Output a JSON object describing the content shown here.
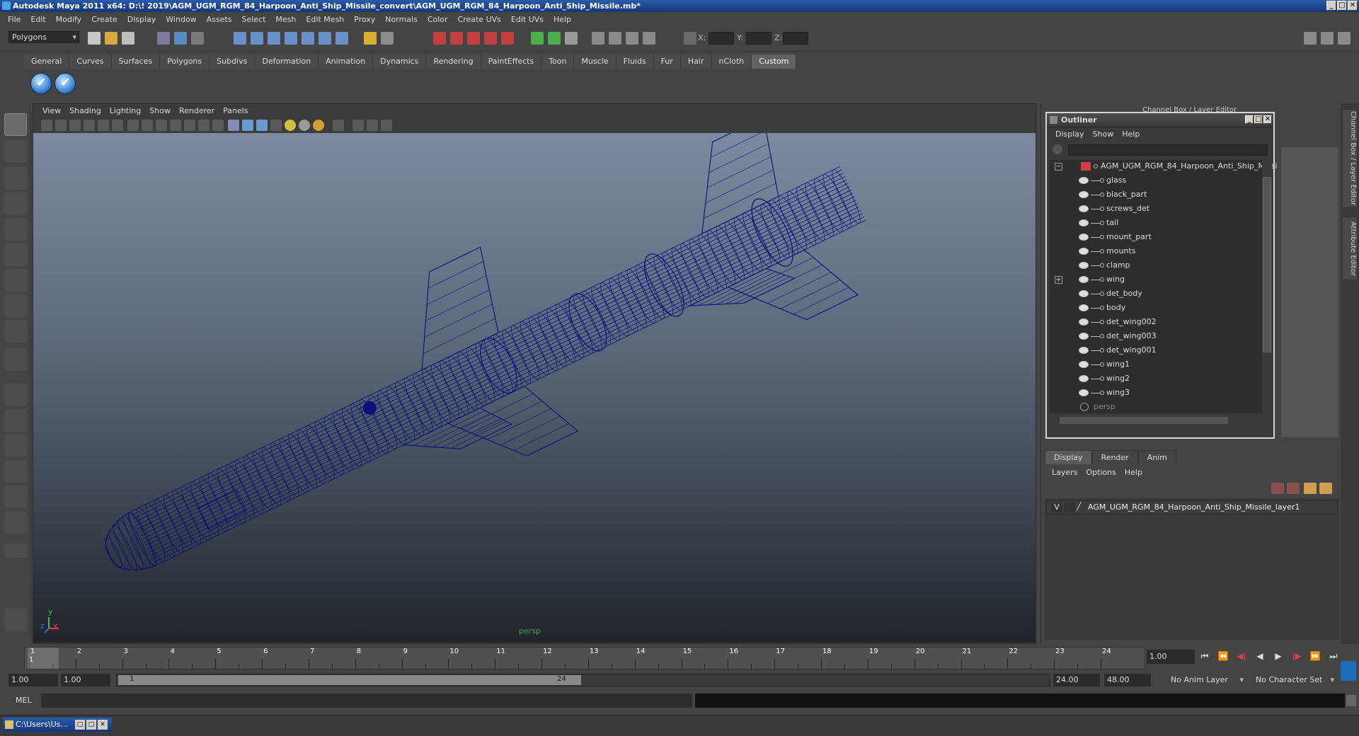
{
  "app": {
    "title": "Autodesk Maya 2011 x64: D:\\! 2019\\AGM_UGM_RGM_84_Harpoon_Anti_Ship_Missile_convert\\AGM_UGM_RGM_84_Harpoon_Anti_Ship_Missile.mb*",
    "window_controls": [
      "_",
      "□",
      "✕"
    ]
  },
  "menubar": [
    "File",
    "Edit",
    "Modify",
    "Create",
    "Display",
    "Window",
    "Assets",
    "Select",
    "Mesh",
    "Edit Mesh",
    "Proxy",
    "Normals",
    "Color",
    "Create UVs",
    "Edit UVs",
    "Help"
  ],
  "statusline": {
    "mode": "Polygons",
    "x_label": "X:",
    "y_label": "Y:",
    "z_label": "Z:"
  },
  "shelf": {
    "tabs": [
      "General",
      "Curves",
      "Surfaces",
      "Polygons",
      "Subdivs",
      "Deformation",
      "Animation",
      "Dynamics",
      "Rendering",
      "PaintEffects",
      "Toon",
      "Muscle",
      "Fluids",
      "Fur",
      "Hair",
      "nCloth",
      "Custom"
    ],
    "active_tab": "Custom"
  },
  "viewport": {
    "menu": [
      "View",
      "Shading",
      "Lighting",
      "Show",
      "Renderer",
      "Panels"
    ],
    "camera_label": "persp",
    "axis_y": "y",
    "axis_x": "x",
    "axis_z": "z",
    "wire_color": "#0a0f7a"
  },
  "channelbox": {
    "title": "Channel Box / Layer Editor"
  },
  "outliner": {
    "title": "Outliner",
    "menu": [
      "Display",
      "Show",
      "Help"
    ],
    "root": "AGM_UGM_RGM_84_Harpoon_Anti_Ship_Missi",
    "items": [
      "glass",
      "black_part",
      "screws_det",
      "tail",
      "mount_part",
      "mounts",
      "clamp",
      "wing",
      "det_body",
      "body",
      "det_wing002",
      "det_wing003",
      "det_wing001",
      "wing1",
      "wing2",
      "wing3"
    ],
    "camera_item": "persp",
    "expand_minus": "−",
    "expand_plus": "+"
  },
  "side_tabs": [
    "Channel Box / Layer Editor",
    "Attribute Editor"
  ],
  "layer_editor": {
    "tabs": [
      "Display",
      "Render",
      "Anim"
    ],
    "active_tab": "Display",
    "menu": [
      "Layers",
      "Options",
      "Help"
    ],
    "layer": {
      "visible": "V",
      "name": "AGM_UGM_RGM_84_Harpoon_Anti_Ship_Missile_layer1"
    }
  },
  "timeline": {
    "ticks": [
      "1",
      "2",
      "3",
      "4",
      "5",
      "6",
      "7",
      "8",
      "9",
      "10",
      "11",
      "12",
      "13",
      "14",
      "15",
      "16",
      "17",
      "18",
      "19",
      "20",
      "21",
      "22",
      "23",
      "24"
    ],
    "current_frame_marker": "1",
    "current_frame": "1.00",
    "play_buttons": [
      "⏮",
      "⏪",
      "◀|",
      "◀",
      "▶",
      "|▶",
      "⏩",
      "⏭"
    ]
  },
  "range": {
    "start": "1.00",
    "playback_start": "1.00",
    "slider_start": "1",
    "slider_end": "24",
    "playback_end": "24.00",
    "end": "48.00",
    "anim_layer": "No Anim Layer",
    "character_set": "No Character Set"
  },
  "cmdline": {
    "label": "MEL"
  },
  "taskbar": {
    "item": "C:\\Users\\Us..."
  }
}
